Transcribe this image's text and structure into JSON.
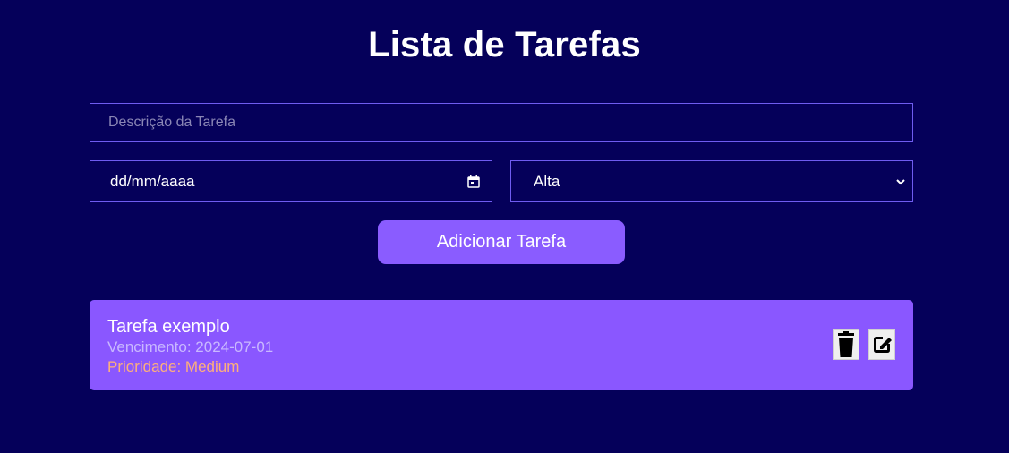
{
  "page": {
    "title": "Lista de Tarefas"
  },
  "form": {
    "description_placeholder": "Descrição da Tarefa",
    "description_value": "",
    "date_placeholder": "dd/mm/aaaa",
    "priority_selected": "Alta",
    "add_button_label": "Adicionar Tarefa"
  },
  "tasks": [
    {
      "name": "Tarefa exemplo",
      "due": "Vencimento: 2024-07-01",
      "priority": "Prioridade: Medium"
    }
  ],
  "icons": {
    "delete": "trash-icon",
    "edit": "edit-icon",
    "calendar": "calendar-icon",
    "dropdown": "chevron-down-icon"
  },
  "colors": {
    "background": "#05005a",
    "accent": "#8a5cff",
    "field_border": "#6f5cf0",
    "priority_text": "#ffb07a",
    "due_text": "#c9b8ff"
  }
}
